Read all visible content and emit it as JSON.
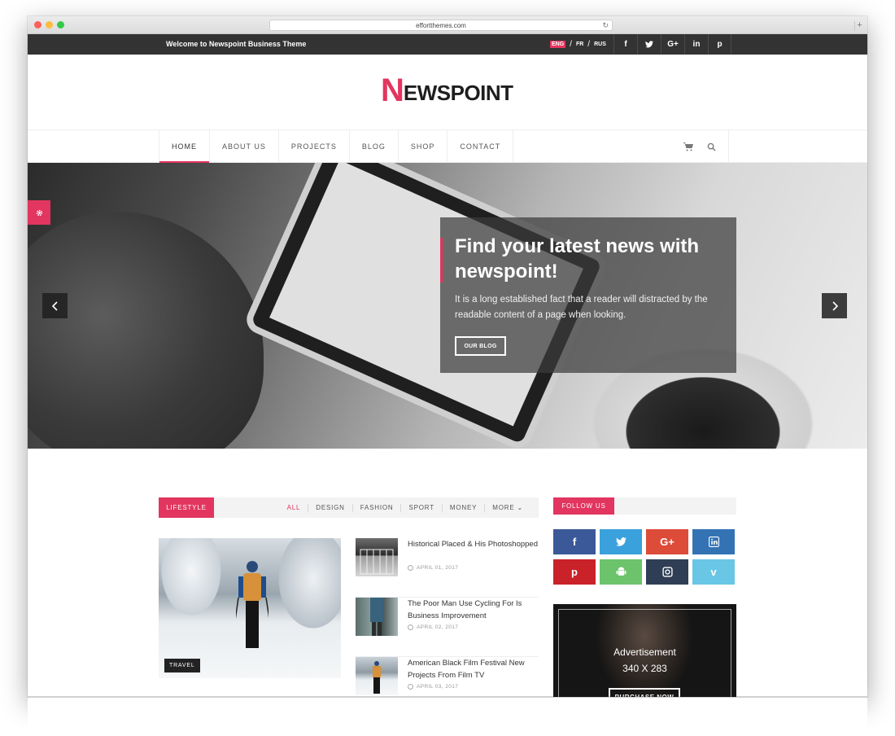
{
  "browser": {
    "url": "effortthemes.com"
  },
  "topbar": {
    "welcome": "Welcome to Newspoint Business Theme",
    "languages": [
      {
        "code": "ENG",
        "active": true
      },
      {
        "code": "FR",
        "active": false
      },
      {
        "code": "RUS",
        "active": false
      }
    ],
    "language_separator": "/",
    "socials": [
      {
        "icon": "facebook-icon",
        "glyph": "f"
      },
      {
        "icon": "twitter-icon",
        "glyph": "t"
      },
      {
        "icon": "google-plus-icon",
        "glyph": "G+"
      },
      {
        "icon": "linkedin-icon",
        "glyph": "in"
      },
      {
        "icon": "pinterest-icon",
        "glyph": "p"
      }
    ]
  },
  "logo": {
    "initial": "N",
    "rest": "EWSPOINT"
  },
  "nav": {
    "items": [
      "HOME",
      "ABOUT US",
      "PROJECTS",
      "BLOG",
      "SHOP",
      "CONTACT"
    ],
    "active_index": 0
  },
  "hero": {
    "title": "Find your latest news with newspoint!",
    "text": "It is a long established fact that a reader will distracted by the readable content of a page when looking.",
    "button": "OUR BLOG"
  },
  "category_section": {
    "label": "LIFESTYLE",
    "filters": [
      "ALL",
      "DESIGN",
      "FASHION",
      "SPORT",
      "MONEY",
      "MORE"
    ],
    "active_filter": 0,
    "feature_tag": "TRAVEL",
    "posts": [
      {
        "title": "Historical Placed & His Photoshopped",
        "date": "APRIL 01, 2017"
      },
      {
        "title": "The Poor Man Use Cycling For Is Business Improvement",
        "date": "APRIL 02, 2017"
      },
      {
        "title": "American Black Film Festival New Projects From Film TV",
        "date": "APRIL 03, 2017"
      }
    ]
  },
  "follow": {
    "label": "FOLLOW US",
    "networks": [
      {
        "icon": "facebook-icon",
        "glyph": "f",
        "color": "#3b5998"
      },
      {
        "icon": "twitter-icon",
        "glyph": "t",
        "color": "#3aa1dc"
      },
      {
        "icon": "google-plus-icon",
        "glyph": "G+",
        "color": "#dd4b39"
      },
      {
        "icon": "linkedin-icon",
        "glyph": "in",
        "color": "#3373b4"
      },
      {
        "icon": "pinterest-icon",
        "glyph": "p",
        "color": "#c92228"
      },
      {
        "icon": "android-icon",
        "glyph": "A",
        "color": "#6cc36b"
      },
      {
        "icon": "instagram-icon",
        "glyph": "◘",
        "color": "#2f3e55"
      },
      {
        "icon": "vimeo-icon",
        "glyph": "v",
        "color": "#69c6e5"
      }
    ]
  },
  "ad": {
    "title": "Advertisement",
    "size": "340 X 283",
    "button": "PURCHASE NOW"
  },
  "colors": {
    "accent": "#e2355f",
    "topbar": "#333333"
  }
}
